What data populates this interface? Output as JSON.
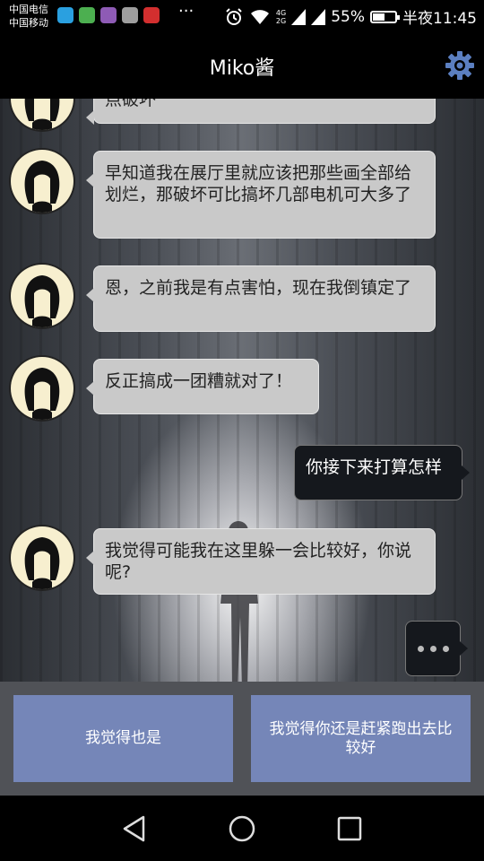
{
  "status_bar": {
    "carrier1": "中国电信",
    "carrier2": "中国移动",
    "more": "···",
    "net1": "4G",
    "net2": "2G",
    "battery_percent": "55%",
    "battery_level": 0.55,
    "time": "半夜11:45"
  },
  "header": {
    "title": "Miko酱",
    "settings_icon": "gear-icon",
    "accent_color": "#5b7fc1"
  },
  "messages": [
    {
      "side": "left",
      "text": "点破坏"
    },
    {
      "side": "left",
      "text": "早知道我在展厅里就应该把那些画全部给划烂，那破坏可比搞坏几部电机可大多了"
    },
    {
      "side": "left",
      "text": "恩，之前我是有点害怕，现在我倒镇定了"
    },
    {
      "side": "left",
      "text": "反正搞成一团糟就对了！"
    },
    {
      "side": "right",
      "text": "你接下来打算怎样"
    },
    {
      "side": "left",
      "text": "我觉得可能我在这里躲一会比较好，你说呢?"
    }
  ],
  "choices": [
    {
      "label": "我觉得也是"
    },
    {
      "label": "我觉得你还是赶紧跑出去比较好"
    }
  ],
  "choice_color": "#7586b8",
  "nav": {
    "back_icon": "back-triangle-icon",
    "home_icon": "home-circle-icon",
    "recent_icon": "recent-square-icon"
  }
}
